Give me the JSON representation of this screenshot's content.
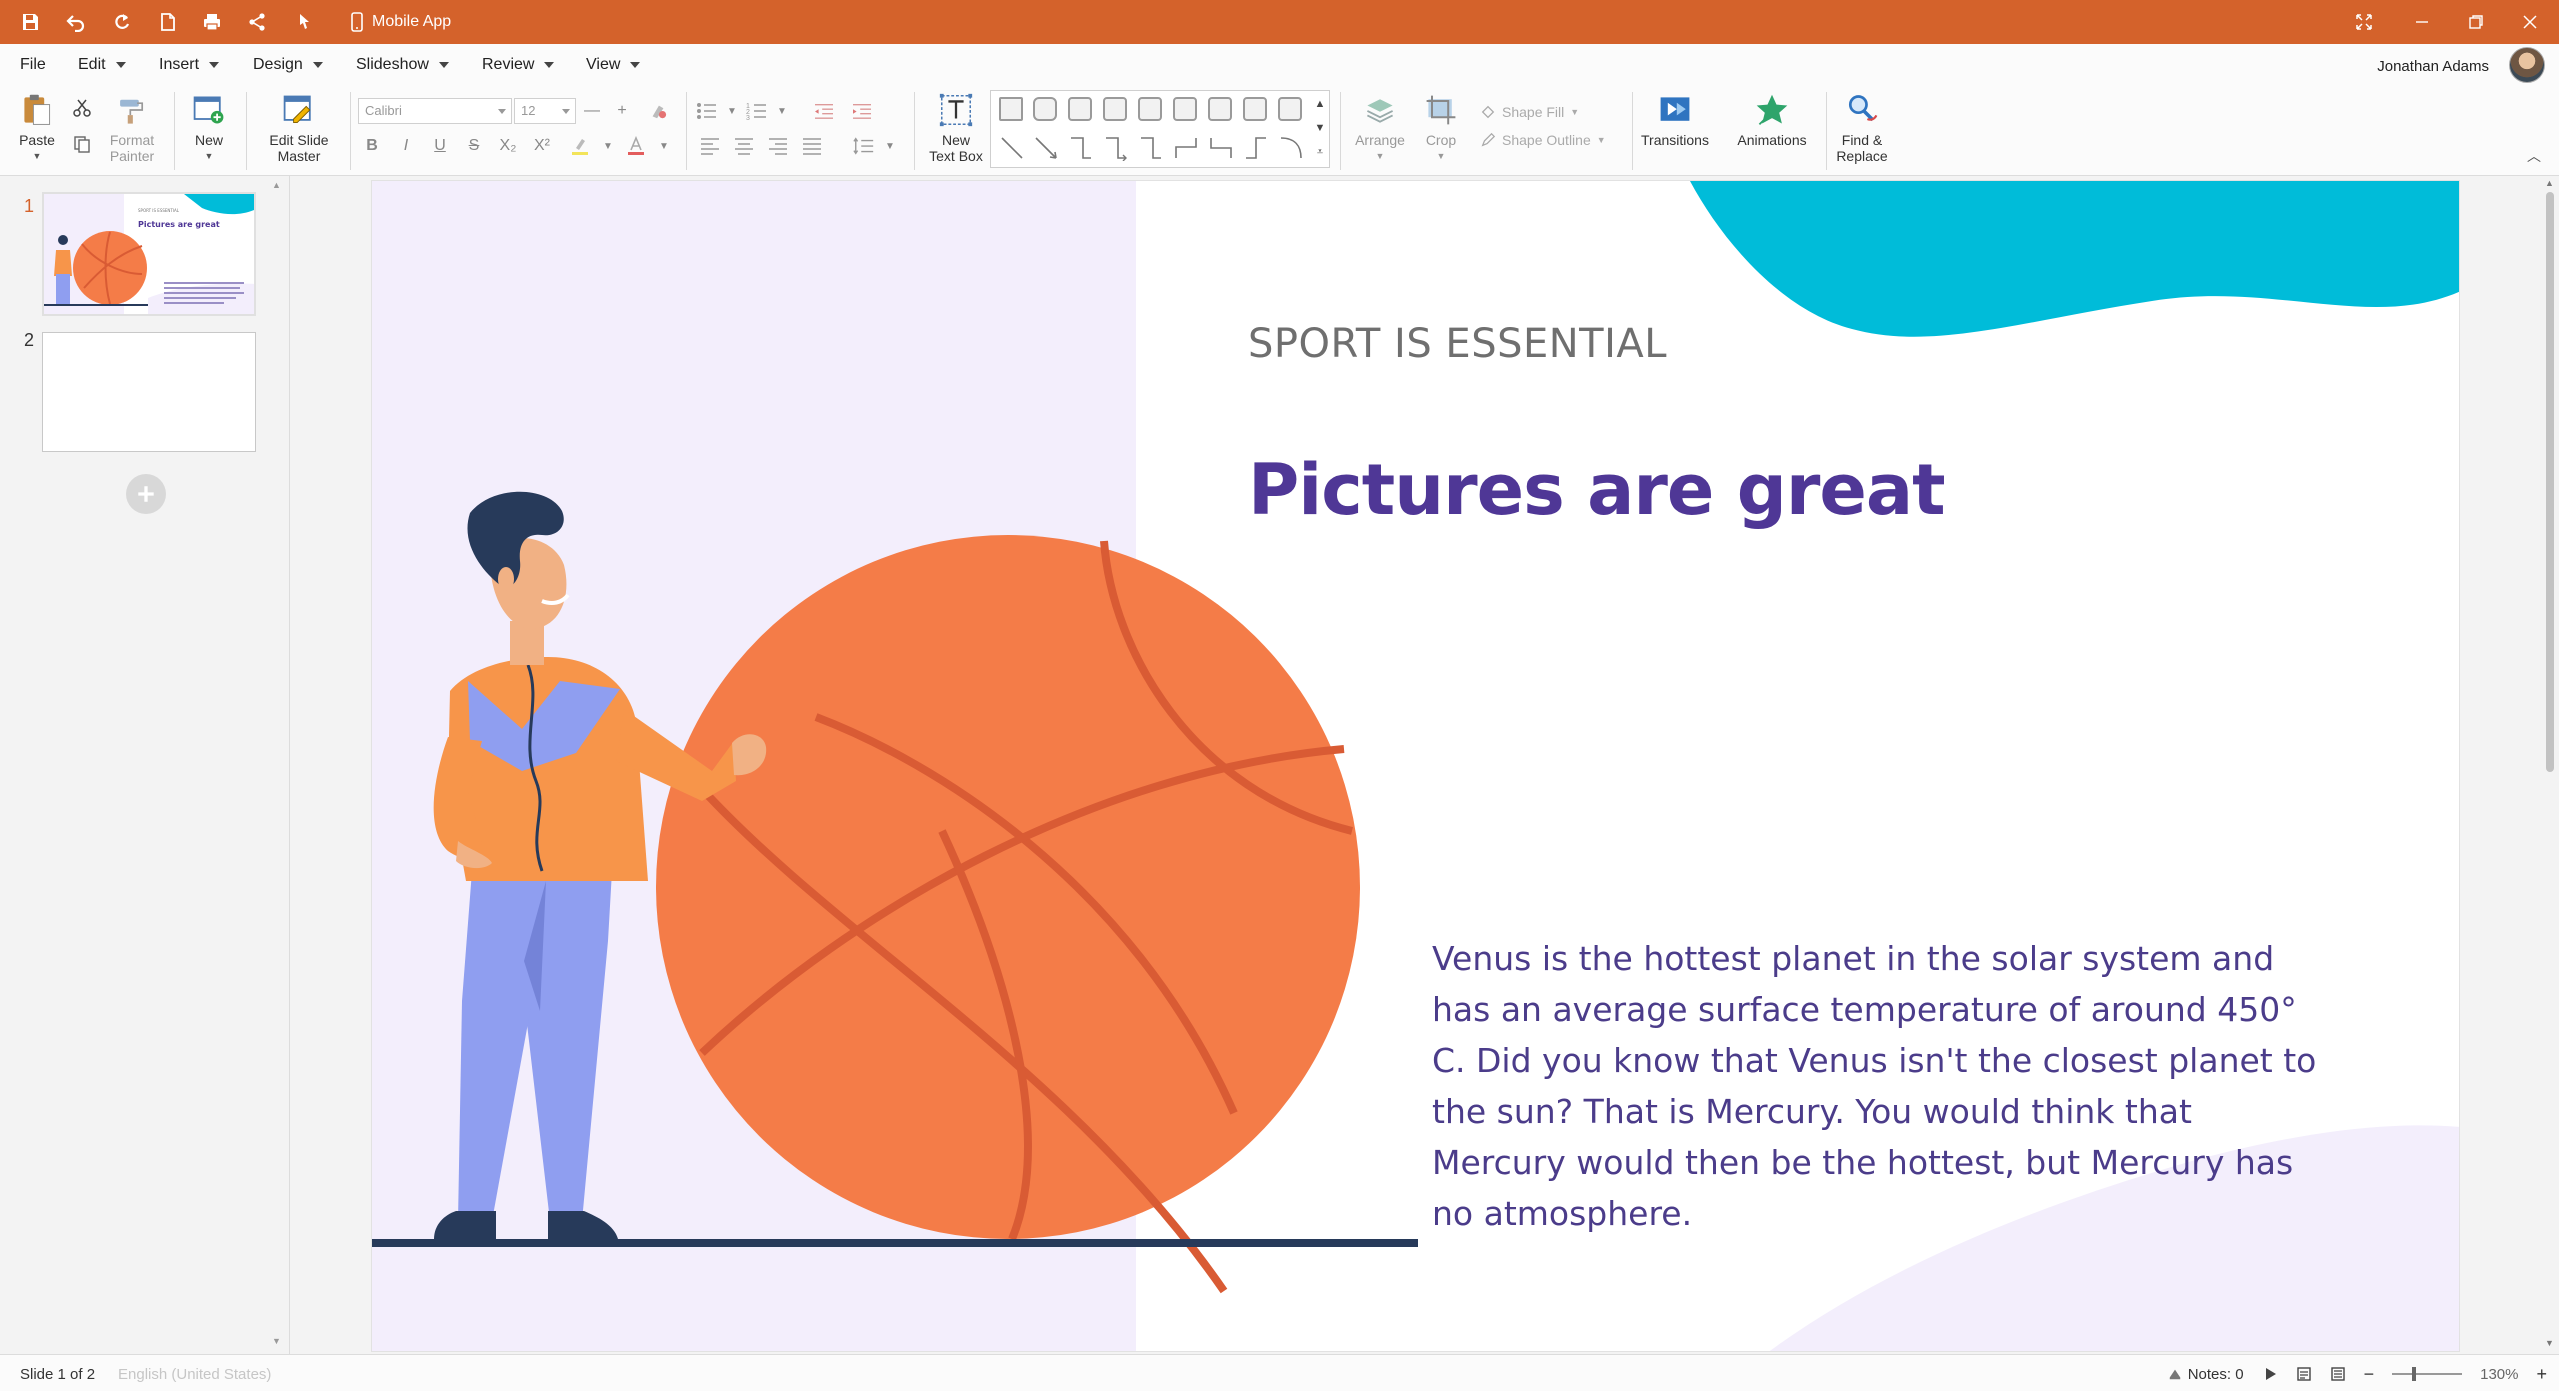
{
  "window": {
    "title": "Mobile App"
  },
  "menu": {
    "items": [
      {
        "label": "File",
        "has_caret": false
      },
      {
        "label": "Edit",
        "has_caret": true
      },
      {
        "label": "Insert",
        "has_caret": true
      },
      {
        "label": "Design",
        "has_caret": true
      },
      {
        "label": "Slideshow",
        "has_caret": true
      },
      {
        "label": "Review",
        "has_caret": true
      },
      {
        "label": "View",
        "has_caret": true
      }
    ],
    "user_name": "Jonathan Adams"
  },
  "ribbon": {
    "paste": "Paste",
    "format_painter": "Format Painter",
    "new": "New",
    "edit_slide_master": "Edit Slide Master",
    "font_family": "Calibri",
    "font_size": "12",
    "new_text_box": "New Text Box",
    "arrange": "Arrange",
    "crop": "Crop",
    "shape_fill": "Shape Fill",
    "shape_outline": "Shape Outline",
    "transitions": "Transitions",
    "animations": "Animations",
    "find_replace": "Find & Replace"
  },
  "thumbnails": {
    "numbers": [
      "1",
      "2"
    ],
    "slide1_kicker": "SPORT IS ESSENTIAL",
    "slide1_title": "Pictures are great"
  },
  "slide": {
    "kicker": "SPORT IS ESSENTIAL",
    "title": "Pictures are great",
    "body": "Venus is the hottest planet in the solar system and has an average surface temperature of around 450° C. Did you know that Venus isn't the closest planet to the sun? That is Mercury.  You would think that Mercury would then be the hottest, but Mercury has no atmosphere."
  },
  "status": {
    "slide_counter": "Slide 1 of 2",
    "language": "English (United States)",
    "notes": "Notes: 0",
    "zoom": "130%"
  },
  "colors": {
    "titlebar": "#d4622b",
    "slide_title": "#4f3796",
    "slide_body": "#4b3c8a",
    "ball": "#f47c48",
    "accent_teal": "#00bcd9",
    "lavender": "#f3eefc"
  }
}
